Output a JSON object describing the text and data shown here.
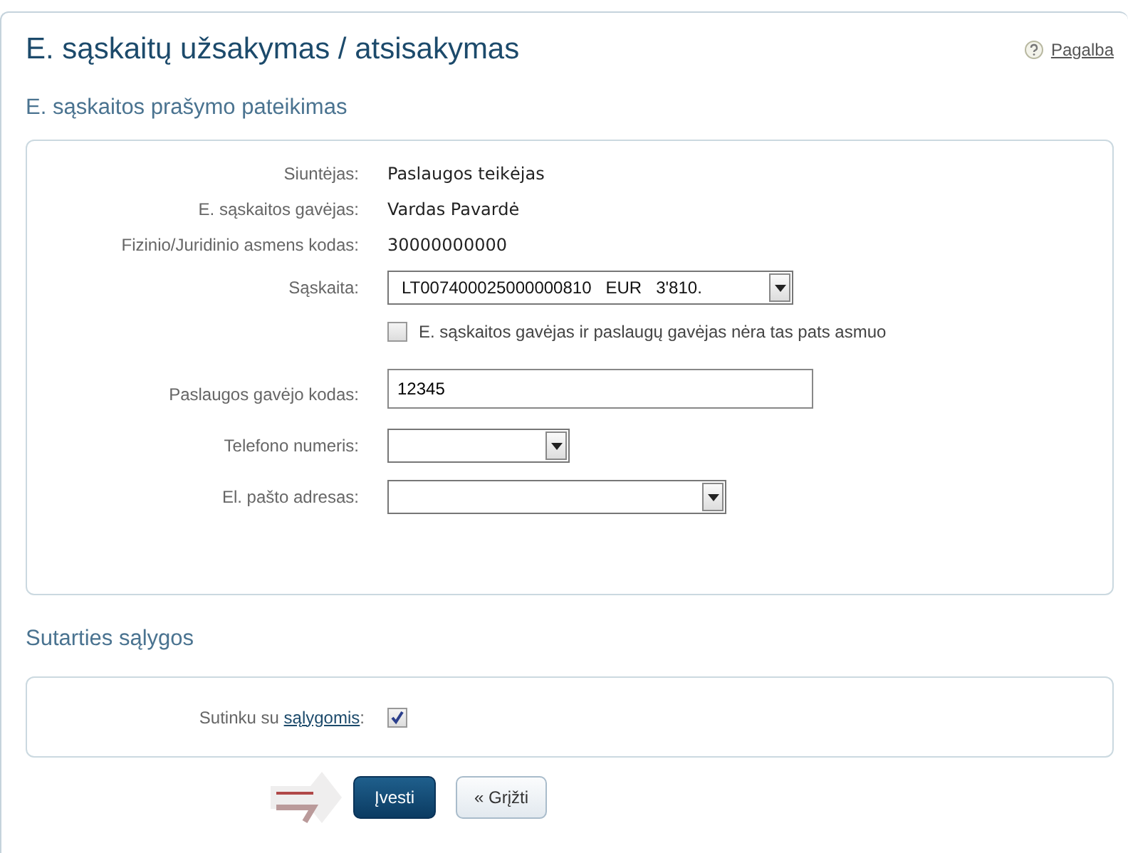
{
  "title": "E. sąskaitų užsakymas / atsisakymas",
  "help_link": "Pagalba",
  "section_1": {
    "heading": "E. sąskaitos prašymo pateikimas",
    "rows": [
      {
        "kind": "text",
        "label": "Siuntėjas:",
        "value": "Paslaugos teikėjas"
      },
      {
        "kind": "text",
        "label": "E. sąskaitos gavėjas:",
        "value": "Vardas Pavardė"
      },
      {
        "kind": "text",
        "label": "Fizinio/Juridinio asmens kodas:",
        "value": "30000000000"
      },
      {
        "kind": "select",
        "label": "Sąskaita:",
        "value": "LT007400025000000810   EUR   3'810."
      },
      {
        "kind": "checkbox",
        "text": "E. sąskaitos gavėjas ir paslaugų gavėjas nėra tas pats asmuo",
        "checked": false
      },
      {
        "kind": "input",
        "label": "Paslaugos gavėjo kodas:",
        "value": "12345"
      },
      {
        "kind": "select",
        "label": "Telefono numeris:"
      },
      {
        "kind": "select",
        "label": "El. pašto adresas:"
      }
    ]
  },
  "section_2": {
    "heading": "Sutarties sąlygos",
    "agree": {
      "prefix": "Sutinku su ",
      "link": "sąlygomis",
      "suffix": ":",
      "checked": true
    }
  },
  "buttons": [
    {
      "kind": "primary",
      "label": "Įvesti"
    },
    {
      "kind": "back",
      "icon": "«",
      "label": "Grįžti"
    }
  ]
}
